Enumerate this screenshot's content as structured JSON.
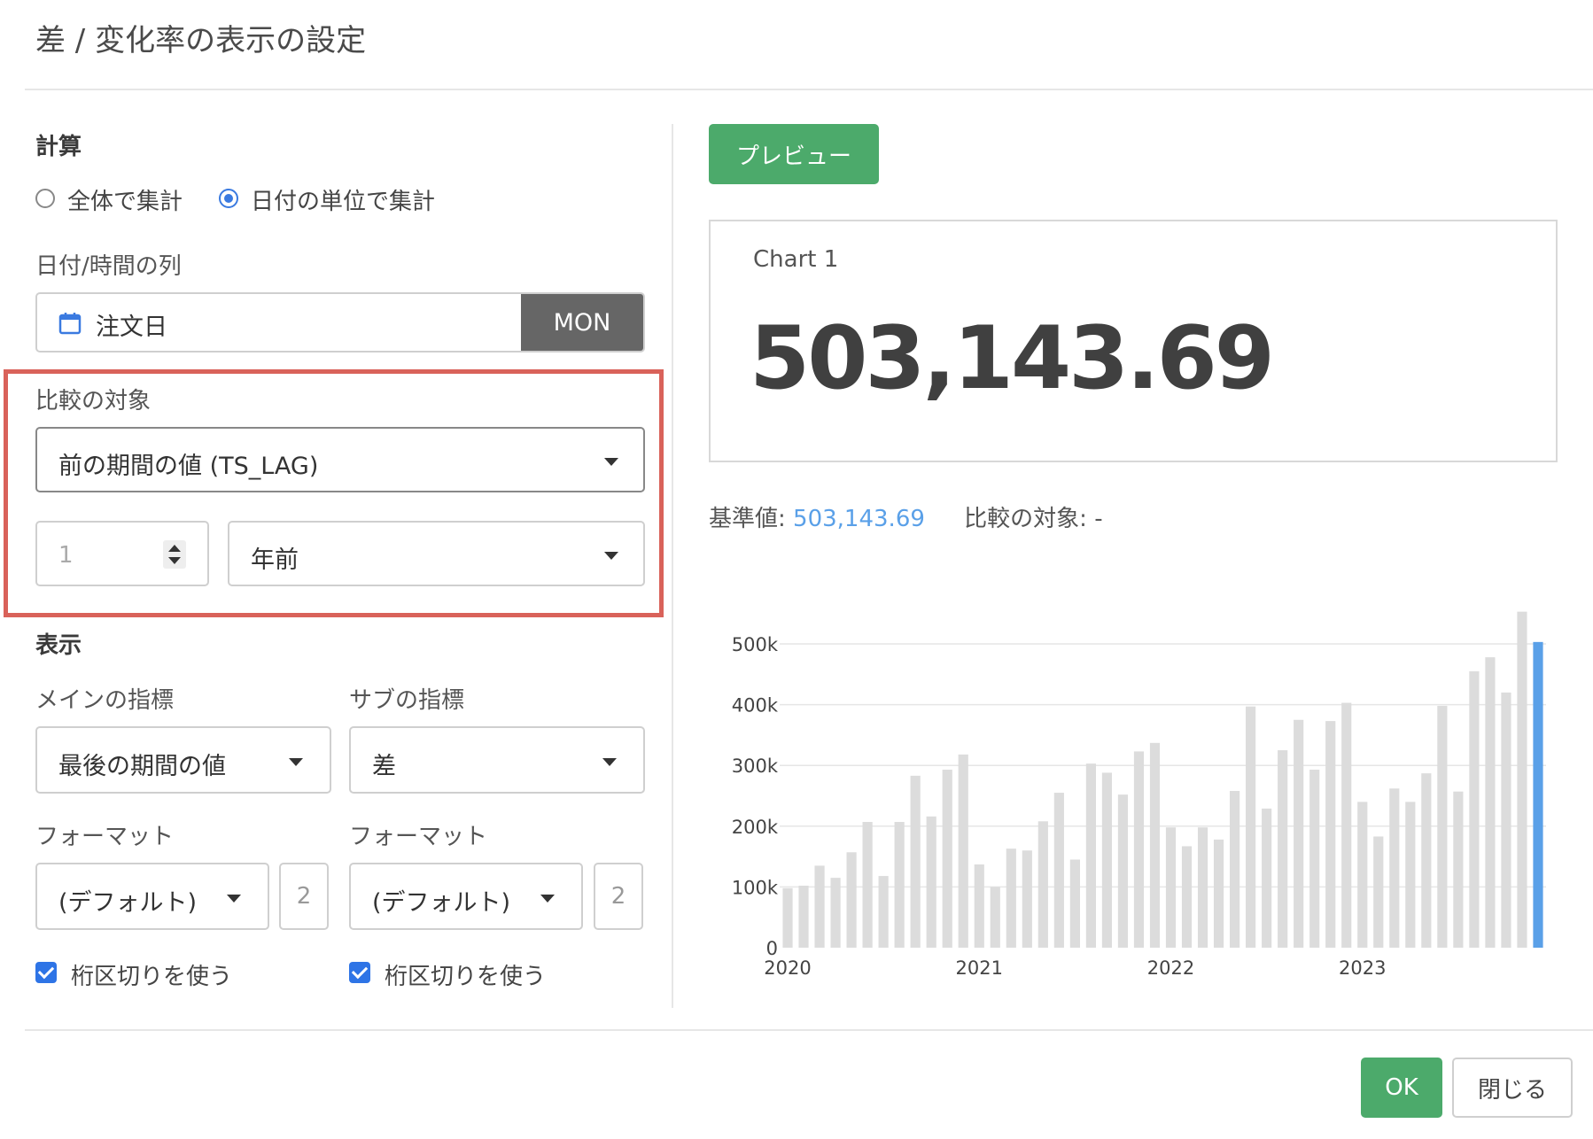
{
  "dialog": {
    "title": "差 / 変化率の表示の設定"
  },
  "calc": {
    "section_label": "計算",
    "radio_all": "全体で集計",
    "radio_by_date": "日付の単位で集計",
    "selected": "radio_by_date",
    "date_column_label": "日付/時間の列",
    "date_column_value": "注文日",
    "date_unit": "MON",
    "compare_label": "比較の対象",
    "compare_value": "前の期間の値 (TS_LAG)",
    "lag_number": "1",
    "lag_unit": "年前"
  },
  "display": {
    "section_label": "表示",
    "main_metric_label": "メインの指標",
    "main_metric_value": "最後の期間の値",
    "sub_metric_label": "サブの指標",
    "sub_metric_value": "差",
    "format_label_main": "フォーマット",
    "format_label_sub": "フォーマット",
    "format_main_value": "(デフォルト)",
    "format_sub_value": "(デフォルト)",
    "decimals_main": "2",
    "decimals_sub": "2",
    "separator_main": "桁区切りを使う",
    "separator_sub": "桁区切りを使う",
    "separator_main_checked": true,
    "separator_sub_checked": true
  },
  "preview": {
    "button_label": "プレビュー",
    "card_title": "Chart 1",
    "big_number": "503,143.69",
    "base_label": "基準値:",
    "base_value": "503,143.69",
    "compare_label": "比較の対象: -"
  },
  "chart_data": {
    "type": "bar",
    "y_ticks": [
      "0",
      "100k",
      "200k",
      "300k",
      "400k",
      "500k"
    ],
    "ylim": [
      0,
      500000
    ],
    "x_tick_labels": [
      "2020",
      "2021",
      "2022",
      "2023"
    ],
    "values": [
      98000,
      102000,
      135000,
      115000,
      157000,
      207000,
      118000,
      207000,
      283000,
      216000,
      293000,
      318000,
      137000,
      100000,
      163000,
      160000,
      208000,
      255000,
      145000,
      303000,
      288000,
      252000,
      323000,
      337000,
      198000,
      167000,
      198000,
      178000,
      258000,
      397000,
      229000,
      325000,
      375000,
      293000,
      373000,
      403000,
      240000,
      183000,
      262000,
      240000,
      287000,
      398000,
      257000,
      455000,
      478000,
      420000,
      553000,
      503143.69
    ],
    "bar_color": "#dcdcdc",
    "highlight_color": "#5aa0e8",
    "highlight_index": 47
  },
  "footer": {
    "ok_label": "OK",
    "close_label": "閉じる"
  },
  "colors": {
    "accent_green": "#4caa6b",
    "highlight_border": "#d9625a",
    "link_blue": "#5aa0e8"
  }
}
